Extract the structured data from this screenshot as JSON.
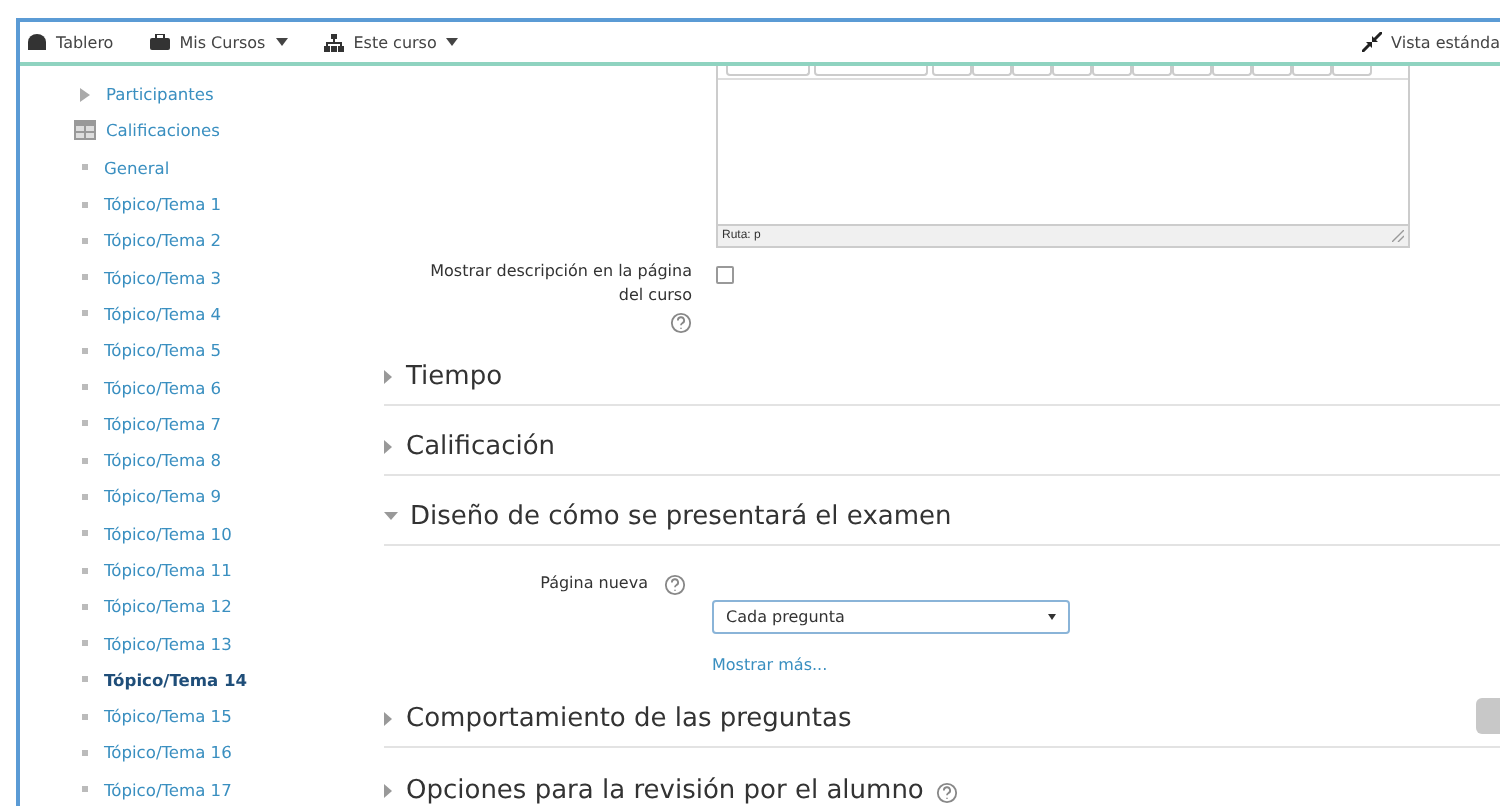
{
  "navbar": {
    "items": [
      {
        "label": "Tablero",
        "caret": false
      },
      {
        "label": "Mis Cursos",
        "caret": true
      },
      {
        "label": "Este curso",
        "caret": true
      }
    ],
    "right": {
      "label": "Vista estánda"
    }
  },
  "sidebar": {
    "items": [
      {
        "label": "Participantes",
        "kind": "expander",
        "selected": false
      },
      {
        "label": "Calificaciones",
        "kind": "table",
        "selected": false
      },
      {
        "label": "General",
        "kind": "bullet",
        "selected": false
      },
      {
        "label": "Tópico/Tema 1",
        "kind": "bullet",
        "selected": false
      },
      {
        "label": "Tópico/Tema 2",
        "kind": "bullet",
        "selected": false
      },
      {
        "label": "Tópico/Tema 3",
        "kind": "bullet",
        "selected": false
      },
      {
        "label": "Tópico/Tema 4",
        "kind": "bullet",
        "selected": false
      },
      {
        "label": "Tópico/Tema 5",
        "kind": "bullet",
        "selected": false
      },
      {
        "label": "Tópico/Tema 6",
        "kind": "bullet",
        "selected": false
      },
      {
        "label": "Tópico/Tema 7",
        "kind": "bullet",
        "selected": false
      },
      {
        "label": "Tópico/Tema 8",
        "kind": "bullet",
        "selected": false
      },
      {
        "label": "Tópico/Tema 9",
        "kind": "bullet",
        "selected": false
      },
      {
        "label": "Tópico/Tema 10",
        "kind": "bullet",
        "selected": false
      },
      {
        "label": "Tópico/Tema 11",
        "kind": "bullet",
        "selected": false
      },
      {
        "label": "Tópico/Tema 12",
        "kind": "bullet",
        "selected": false
      },
      {
        "label": "Tópico/Tema 13",
        "kind": "bullet",
        "selected": false
      },
      {
        "label": "Tópico/Tema 14",
        "kind": "bullet",
        "selected": true
      },
      {
        "label": "Tópico/Tema 15",
        "kind": "bullet",
        "selected": false
      },
      {
        "label": "Tópico/Tema 16",
        "kind": "bullet",
        "selected": false
      },
      {
        "label": "Tópico/Tema 17",
        "kind": "bullet",
        "selected": false
      }
    ]
  },
  "editor": {
    "path": "Ruta: p"
  },
  "show_description": {
    "label": "Mostrar descripción en la página del curso",
    "checked": false
  },
  "sections": [
    {
      "title": "Tiempo",
      "expanded": false,
      "help": false
    },
    {
      "title": "Calificación",
      "expanded": false,
      "help": false
    },
    {
      "title": "Diseño de cómo se presentará el examen",
      "expanded": true,
      "help": false,
      "field": {
        "label": "Página nueva",
        "value": "Cada pregunta"
      },
      "more_link": "Mostrar más..."
    },
    {
      "title": "Comportamiento de las preguntas",
      "expanded": false,
      "help": false
    },
    {
      "title": "Opciones para la revisión por el alumno",
      "expanded": false,
      "help": true
    }
  ]
}
